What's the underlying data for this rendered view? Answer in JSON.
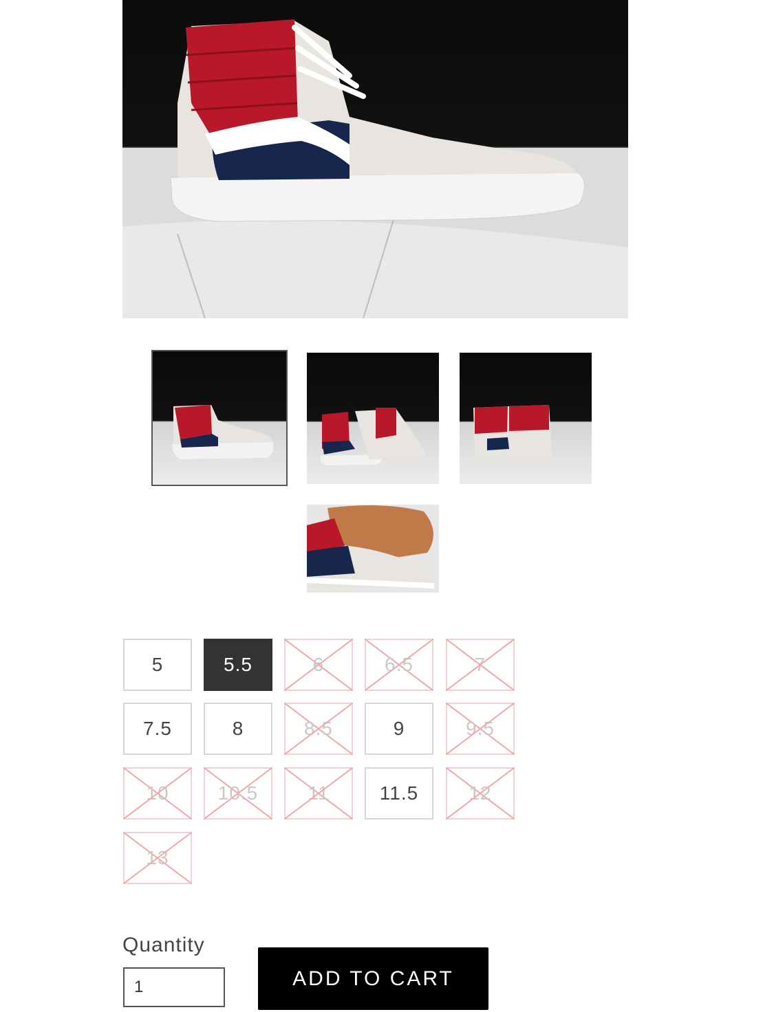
{
  "product": {
    "main_image_alt": "main-product-image",
    "thumbnails": [
      {
        "name": "thumb-side-view",
        "active": true
      },
      {
        "name": "thumb-pair-front-view",
        "active": false
      },
      {
        "name": "thumb-pair-back-view",
        "active": false
      },
      {
        "name": "thumb-sole-view",
        "active": false
      }
    ]
  },
  "sizes": [
    {
      "label": "5",
      "state": "available"
    },
    {
      "label": "5.5",
      "state": "selected"
    },
    {
      "label": "6",
      "state": "unavailable"
    },
    {
      "label": "6.5",
      "state": "unavailable"
    },
    {
      "label": "7",
      "state": "unavailable"
    },
    {
      "label": "7.5",
      "state": "available"
    },
    {
      "label": "8",
      "state": "available"
    },
    {
      "label": "8.5",
      "state": "unavailable"
    },
    {
      "label": "9",
      "state": "available"
    },
    {
      "label": "9.5",
      "state": "unavailable"
    },
    {
      "label": "10",
      "state": "unavailable"
    },
    {
      "label": "10.5",
      "state": "unavailable"
    },
    {
      "label": "11",
      "state": "unavailable"
    },
    {
      "label": "11.5",
      "state": "available"
    },
    {
      "label": "12",
      "state": "unavailable"
    },
    {
      "label": "13",
      "state": "unavailable"
    }
  ],
  "quantity": {
    "label": "Quantity",
    "value": "1"
  },
  "cart": {
    "button_label": "ADD TO CART"
  },
  "colors": {
    "selected_bg": "#333333",
    "unavailable_cross": "#f0a8a8",
    "button_bg": "#000000"
  }
}
